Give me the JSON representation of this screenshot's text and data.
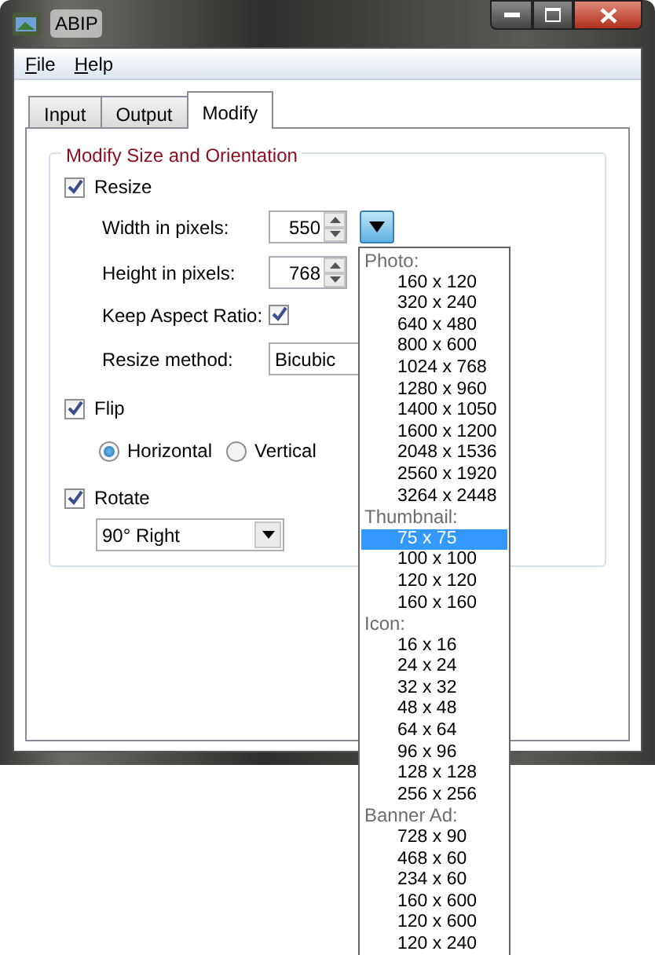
{
  "window": {
    "title": "ABIP"
  },
  "menu": [
    {
      "label": "File"
    },
    {
      "label": "Help"
    }
  ],
  "tabs": [
    {
      "label": "Input",
      "selected": false
    },
    {
      "label": "Output",
      "selected": false
    },
    {
      "label": "Modify",
      "selected": true
    }
  ],
  "group": {
    "title": "Modify Size and Orientation"
  },
  "resize": {
    "label": "Resize",
    "checked": true,
    "width_label": "Width in pixels:",
    "width_value": "550",
    "height_label": "Height in pixels:",
    "height_value": "768",
    "keep_aspect_label": "Keep Aspect Ratio:",
    "keep_aspect_checked": true,
    "method_label": "Resize method:",
    "method_value": "Bicubic"
  },
  "flip": {
    "label": "Flip",
    "checked": true,
    "options": [
      {
        "label": "Horizontal",
        "selected": true
      },
      {
        "label": "Vertical",
        "selected": false
      }
    ]
  },
  "rotate": {
    "label": "Rotate",
    "checked": true,
    "value": "90° Right"
  },
  "size_dropdown": {
    "expanded": true,
    "groups": [
      {
        "header": "Photo:",
        "items": [
          {
            "label": "160 x 120",
            "selected": false
          },
          {
            "label": "320 x 240",
            "selected": false
          },
          {
            "label": "640 x 480",
            "selected": false
          },
          {
            "label": "800 x 600",
            "selected": false
          },
          {
            "label": "1024 x 768",
            "selected": false
          },
          {
            "label": "1280 x 960",
            "selected": false
          },
          {
            "label": "1400 x 1050",
            "selected": false
          },
          {
            "label": "1600 x 1200",
            "selected": false
          },
          {
            "label": "2048 x 1536",
            "selected": false
          },
          {
            "label": "2560 x 1920",
            "selected": false
          },
          {
            "label": "3264 x 2448",
            "selected": false
          }
        ]
      },
      {
        "header": "Thumbnail:",
        "items": [
          {
            "label": "75 x 75",
            "selected": true
          },
          {
            "label": "100 x 100",
            "selected": false
          },
          {
            "label": "120 x 120",
            "selected": false
          },
          {
            "label": "160 x 160",
            "selected": false
          }
        ]
      },
      {
        "header": "Icon:",
        "items": [
          {
            "label": "16 x 16",
            "selected": false
          },
          {
            "label": "24 x 24",
            "selected": false
          },
          {
            "label": "32 x 32",
            "selected": false
          },
          {
            "label": "48 x 48",
            "selected": false
          },
          {
            "label": "64 x 64",
            "selected": false
          },
          {
            "label": "96 x 96",
            "selected": false
          },
          {
            "label": "128 x 128",
            "selected": false
          },
          {
            "label": "256 x 256",
            "selected": false
          }
        ]
      },
      {
        "header": "Banner Ad:",
        "items": [
          {
            "label": "728 x 90",
            "selected": false
          },
          {
            "label": "468 x 60",
            "selected": false
          },
          {
            "label": "234 x 60",
            "selected": false
          },
          {
            "label": "160 x 600",
            "selected": false
          },
          {
            "label": "120 x 600",
            "selected": false
          },
          {
            "label": "120 x 240",
            "selected": false
          }
        ]
      }
    ]
  }
}
